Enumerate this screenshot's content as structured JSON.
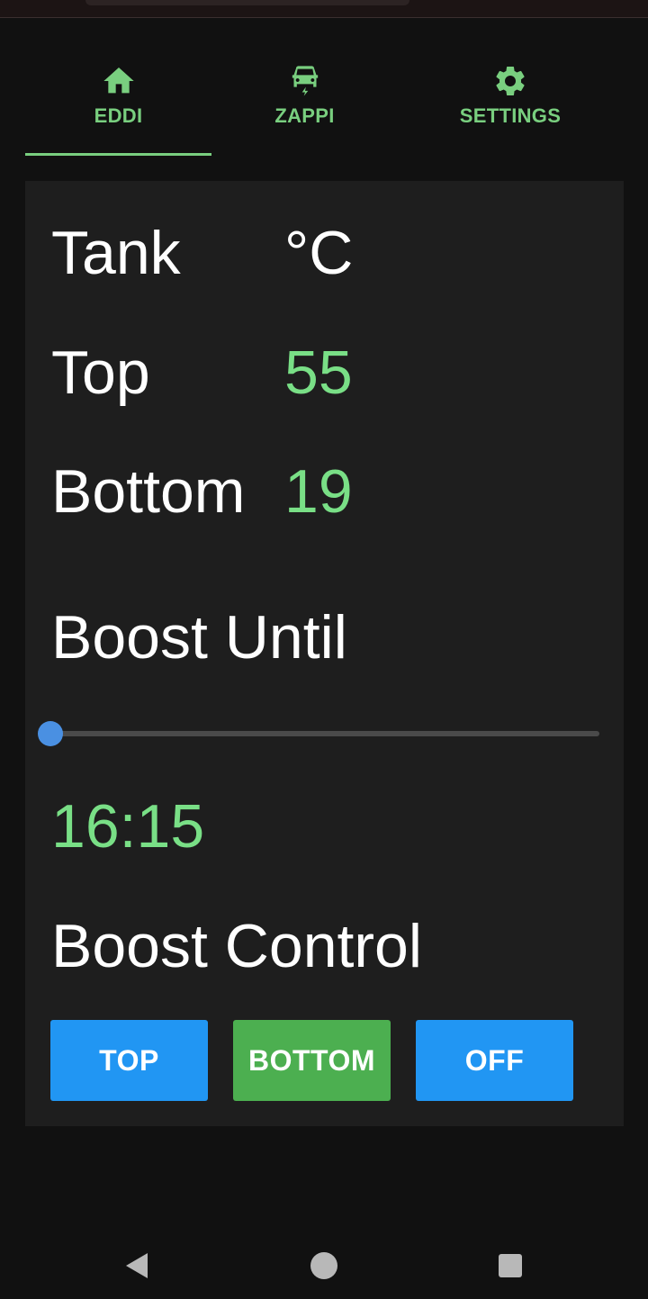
{
  "tabs": [
    {
      "label": "EDDI",
      "icon": "home-icon",
      "active": true
    },
    {
      "label": "ZAPPI",
      "icon": "car-charging-icon",
      "active": false
    },
    {
      "label": "SETTINGS",
      "icon": "gear-icon",
      "active": false
    }
  ],
  "tank": {
    "title": "Tank",
    "unit": "°C",
    "top_label": "Top",
    "top_value": "55",
    "bottom_label": "Bottom",
    "bottom_value": "19"
  },
  "boost": {
    "until_label": "Boost Until",
    "slider_value_fraction": 0,
    "time": "16:15",
    "control_label": "Boost Control",
    "buttons": [
      "TOP",
      "BOTTOM",
      "OFF"
    ]
  },
  "colors": {
    "accent_green": "#79df86",
    "button_blue": "#2196f3",
    "button_green": "#4caf50",
    "slider_thumb": "#4a90e2"
  },
  "nav": [
    "back-icon",
    "home-circle-icon",
    "recents-icon"
  ]
}
